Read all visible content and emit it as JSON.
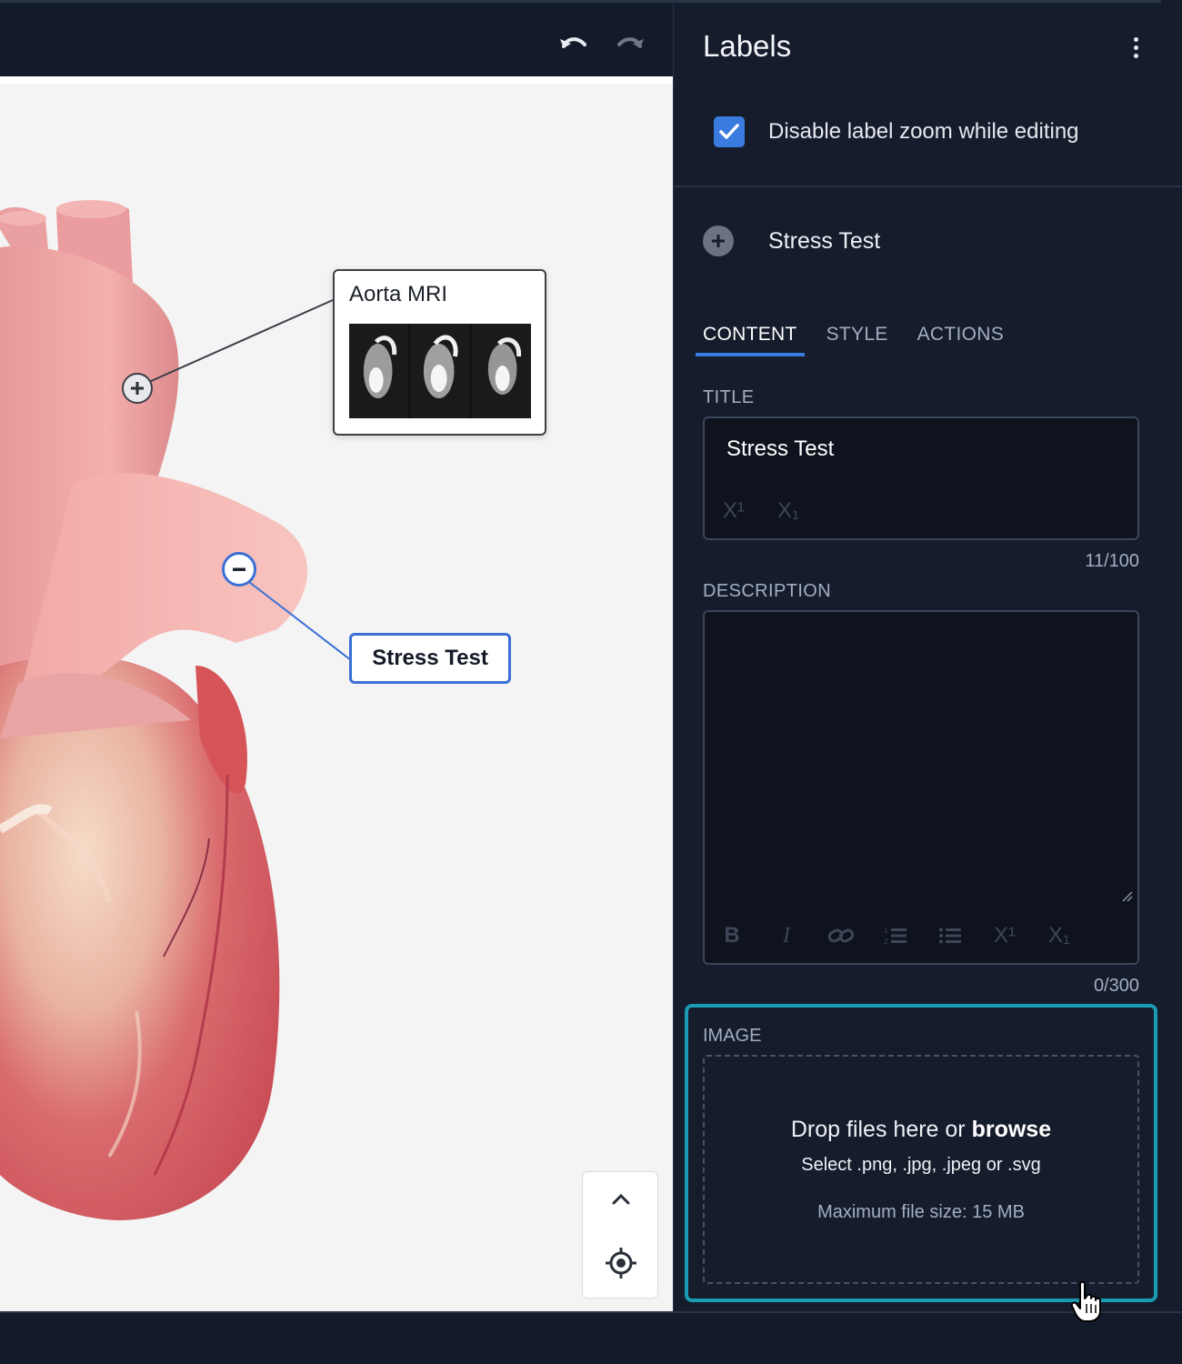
{
  "toolbar": {
    "undo": "undo-icon",
    "redo": "redo-icon"
  },
  "viewport": {
    "labels": [
      {
        "title": "Aorta MRI",
        "kind": "image-label",
        "thumbnails": 3
      },
      {
        "title": "Stress Test",
        "kind": "text-label",
        "selected": true
      }
    ],
    "pins": [
      "plus-icon",
      "minus-icon"
    ],
    "nav": [
      "chevron-up-icon",
      "target-icon"
    ]
  },
  "panel": {
    "title": "Labels",
    "menu_icon": "more-vertical-icon",
    "checkbox": {
      "label": "Disable label zoom while editing",
      "checked": true
    },
    "item": {
      "name": "Stress Test",
      "icon": "plus-circle-icon"
    },
    "tabs": [
      {
        "label": "CONTENT",
        "active": true
      },
      {
        "label": "STYLE",
        "active": false
      },
      {
        "label": "ACTIONS",
        "active": false
      }
    ],
    "title_field": {
      "label": "TITLE",
      "value": "Stress Test",
      "counter": "11/100",
      "format_buttons": [
        "X¹",
        "X₁"
      ]
    },
    "description_field": {
      "label": "DESCRIPTION",
      "value": "",
      "counter": "0/300",
      "format_buttons": [
        "B",
        "I",
        "link-icon",
        "ordered-list-icon",
        "bullet-list-icon",
        "X¹",
        "X₁"
      ]
    },
    "image_field": {
      "label": "IMAGE",
      "drop_text": "Drop files here or",
      "browse": "browse",
      "formats": "Select .png, .jpg, .jpeg or .svg",
      "max_size": "Maximum file size: 15 MB"
    }
  },
  "colors": {
    "panel_bg": "#151c2c",
    "accent": "#3a7be0",
    "highlight": "#1a9bb3",
    "viewport_bg": "#f4f4f4"
  }
}
